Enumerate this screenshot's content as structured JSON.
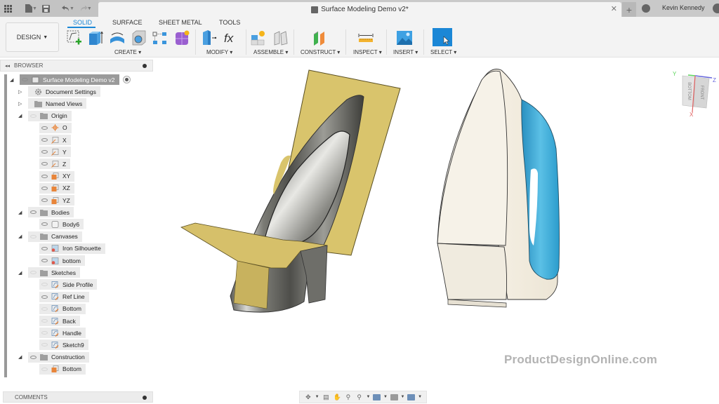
{
  "app": {
    "document_title": "Surface Modeling Demo v2*",
    "user_name": "Kevin Kennedy"
  },
  "quick_access": {
    "icons": [
      "grid-menu-icon",
      "file-icon",
      "save-icon",
      "undo-icon",
      "redo-icon"
    ]
  },
  "toolbar": {
    "workspace_label": "DESIGN",
    "tabs": [
      {
        "label": "SOLID",
        "active": true
      },
      {
        "label": "SURFACE",
        "active": false
      },
      {
        "label": "SHEET METAL",
        "active": false
      },
      {
        "label": "TOOLS",
        "active": false
      }
    ],
    "groups": [
      {
        "label": "CREATE"
      },
      {
        "label": "MODIFY"
      },
      {
        "label": "ASSEMBLE"
      },
      {
        "label": "CONSTRUCT"
      },
      {
        "label": "INSPECT"
      },
      {
        "label": "INSERT"
      },
      {
        "label": "SELECT"
      }
    ]
  },
  "browser": {
    "title": "BROWSER",
    "items": [
      {
        "label": "Surface Modeling Demo v2",
        "level": 0,
        "expanded": true,
        "visible": true,
        "icon": "component-icon"
      },
      {
        "label": "Document Settings",
        "level": 1,
        "expanded": false,
        "icon": "gear-icon"
      },
      {
        "label": "Named Views",
        "level": 1,
        "expanded": false,
        "icon": "folder-icon"
      },
      {
        "label": "Origin",
        "level": 1,
        "expanded": true,
        "visible": false,
        "icon": "folder-icon"
      },
      {
        "label": "O",
        "level": 2,
        "visible": true,
        "icon": "origin-point-icon"
      },
      {
        "label": "X",
        "level": 2,
        "visible": true,
        "icon": "axis-icon"
      },
      {
        "label": "Y",
        "level": 2,
        "visible": true,
        "icon": "axis-icon"
      },
      {
        "label": "Z",
        "level": 2,
        "visible": true,
        "icon": "axis-icon"
      },
      {
        "label": "XY",
        "level": 2,
        "visible": true,
        "icon": "plane-icon"
      },
      {
        "label": "XZ",
        "level": 2,
        "visible": true,
        "icon": "plane-icon"
      },
      {
        "label": "YZ",
        "level": 2,
        "visible": true,
        "icon": "plane-icon"
      },
      {
        "label": "Bodies",
        "level": 1,
        "expanded": true,
        "visible": true,
        "icon": "folder-icon"
      },
      {
        "label": "Body6",
        "level": 2,
        "visible": true,
        "icon": "body-icon"
      },
      {
        "label": "Canvases",
        "level": 1,
        "expanded": true,
        "visible": false,
        "icon": "folder-icon"
      },
      {
        "label": "Iron Silhouette",
        "level": 2,
        "visible": true,
        "icon": "canvas-icon"
      },
      {
        "label": "bottom",
        "level": 2,
        "visible": true,
        "icon": "canvas-icon"
      },
      {
        "label": "Sketches",
        "level": 1,
        "expanded": true,
        "visible": false,
        "icon": "folder-icon"
      },
      {
        "label": "Side Profile",
        "level": 2,
        "visible": false,
        "icon": "sketch-icon"
      },
      {
        "label": "Ref Line",
        "level": 2,
        "visible": true,
        "icon": "sketch-icon"
      },
      {
        "label": "Bottom",
        "level": 2,
        "visible": false,
        "icon": "sketch-icon"
      },
      {
        "label": "Back",
        "level": 2,
        "visible": false,
        "icon": "sketch-icon"
      },
      {
        "label": "Handle",
        "level": 2,
        "visible": false,
        "icon": "sketch-icon"
      },
      {
        "label": "Sketch9",
        "level": 2,
        "visible": false,
        "icon": "sketch-icon"
      },
      {
        "label": "Construction",
        "level": 1,
        "expanded": true,
        "visible": true,
        "icon": "folder-icon"
      },
      {
        "label": "Bottom",
        "level": 2,
        "visible": false,
        "icon": "construction-plane-icon"
      }
    ]
  },
  "comments": {
    "title": "COMMENTS"
  },
  "viewcube": {
    "faces": [
      "BOTTOM",
      "FRONT"
    ],
    "axes": [
      "X",
      "Y",
      "Z"
    ]
  },
  "viewport": {
    "watermark": "ProductDesignOnline.com"
  },
  "navbar": {
    "icons": [
      "orbit-icon",
      "look-at-icon",
      "pan-icon",
      "zoom-icon",
      "fit-icon",
      "display-settings-icon",
      "grid-settings-icon",
      "viewports-icon"
    ]
  },
  "colors": {
    "accent": "#1b87d6",
    "surface_gold": "#d8c26a",
    "handle_blue": "#3aa9d3",
    "body_cream": "#f4efe2",
    "watermark": "#b3b3b3"
  }
}
